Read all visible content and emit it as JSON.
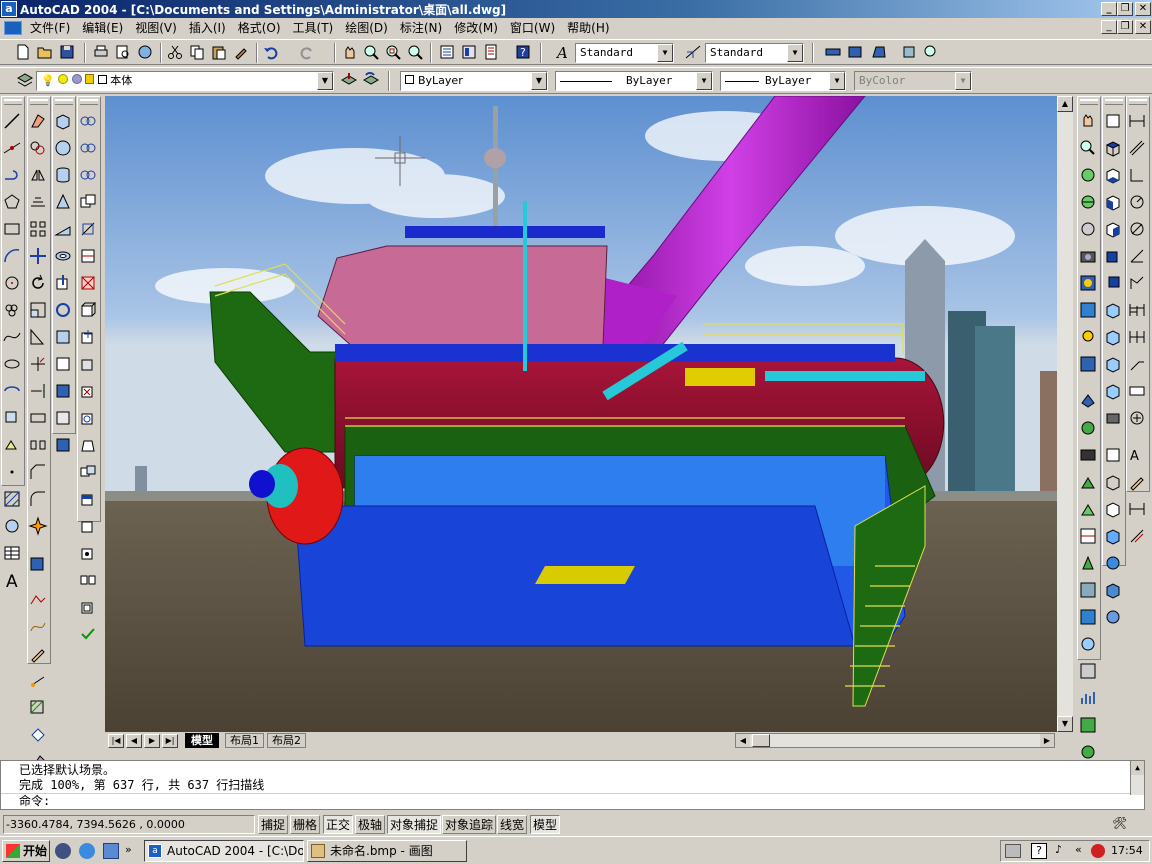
{
  "window": {
    "title": "AutoCAD 2004 - [C:\\Documents and Settings\\Administrator\\桌面\\all.dwg]"
  },
  "menu": [
    "文件(F)",
    "编辑(E)",
    "视图(V)",
    "插入(I)",
    "格式(O)",
    "工具(T)",
    "绘图(D)",
    "标注(N)",
    "修改(M)",
    "窗口(W)",
    "帮助(H)"
  ],
  "toolbar": {
    "text_style": "Standard",
    "dim_style": "Standard"
  },
  "layers": {
    "current": "本体",
    "color": "ByLayer",
    "linetype": "ByLayer",
    "lineweight": "ByLayer",
    "plotstyle": "ByColor"
  },
  "layout_tabs": [
    "模型",
    "布局1",
    "布局2"
  ],
  "command": {
    "lines": [
      "已选择默认场景。",
      "完成 100%, 第 637 行, 共 637 行扫描线"
    ],
    "prompt": "命令:"
  },
  "status": {
    "coords": "-3360.4784,  7394.5626 ,  0.0000",
    "toggles": [
      {
        "label": "捕捉",
        "on": false
      },
      {
        "label": "栅格",
        "on": false
      },
      {
        "label": "正交",
        "on": true
      },
      {
        "label": "极轴",
        "on": false
      },
      {
        "label": "对象捕捉",
        "on": true
      },
      {
        "label": "对象追踪",
        "on": false
      },
      {
        "label": "线宽",
        "on": false
      },
      {
        "label": "模型",
        "on": true
      }
    ]
  },
  "taskbar": {
    "start": "开始",
    "tasks": [
      {
        "label": "AutoCAD 2004 - [C:\\Doc...",
        "active": true
      },
      {
        "label": "未命名.bmp - 画图",
        "active": false
      }
    ],
    "time": "17:54"
  },
  "colors": {
    "title_start": "#0a246a",
    "title_end": "#a6caf0",
    "chrome": "#d4d0c8",
    "hull_red": "#8b0d2a",
    "deck_green": "#1d6a12",
    "duct_magenta": "#b41ec8",
    "base_blue": "#1240d8",
    "pipe_cyan": "#27c8d8",
    "rail_yellow": "#e0e04a"
  }
}
